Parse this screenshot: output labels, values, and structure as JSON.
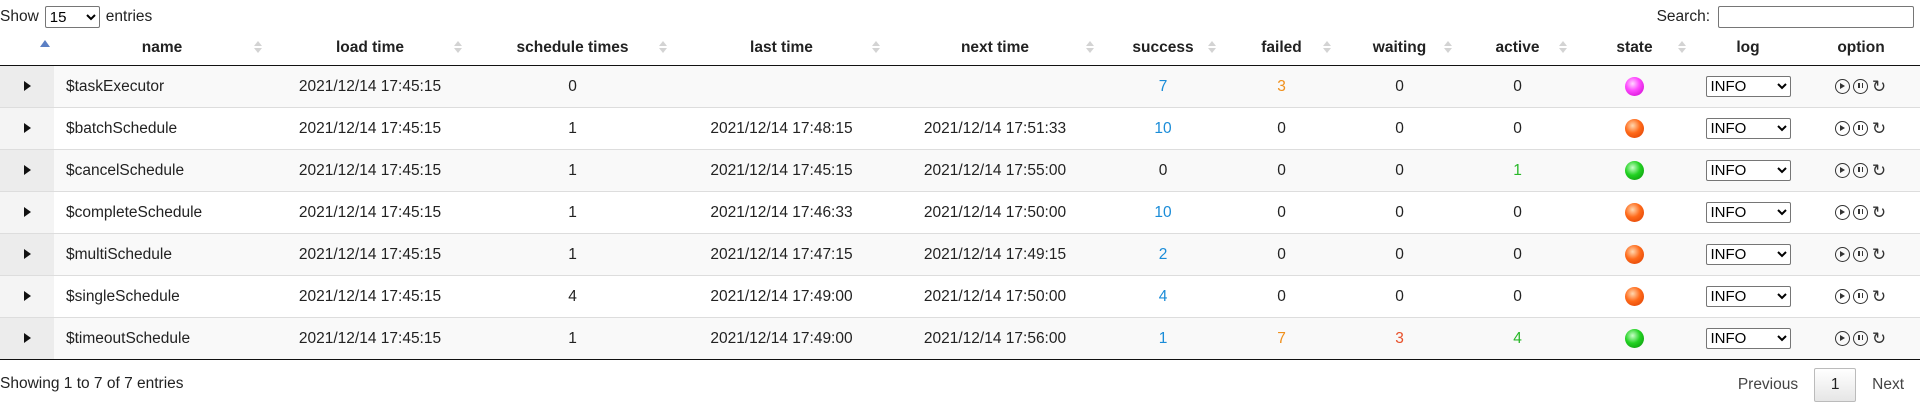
{
  "length_control": {
    "prefix": "Show",
    "value": "15",
    "suffix": "entries"
  },
  "search": {
    "label": "Search:",
    "value": ""
  },
  "columns": [
    "name",
    "load time",
    "schedule times",
    "last time",
    "next time",
    "success",
    "failed",
    "waiting",
    "active",
    "state",
    "log",
    "option"
  ],
  "rows": [
    {
      "name": "$taskExecutor",
      "load_time": "2021/12/14 17:45:15",
      "schedule_times": "0",
      "last_time": "",
      "next_time": "",
      "success": "7",
      "failed": "3",
      "waiting": "0",
      "active": "0",
      "state": "magenta",
      "log": "INFO"
    },
    {
      "name": "$batchSchedule",
      "load_time": "2021/12/14 17:45:15",
      "schedule_times": "1",
      "last_time": "2021/12/14 17:48:15",
      "next_time": "2021/12/14 17:51:33",
      "success": "10",
      "failed": "0",
      "waiting": "0",
      "active": "0",
      "state": "orange",
      "log": "INFO"
    },
    {
      "name": "$cancelSchedule",
      "load_time": "2021/12/14 17:45:15",
      "schedule_times": "1",
      "last_time": "2021/12/14 17:45:15",
      "next_time": "2021/12/14 17:55:00",
      "success": "0",
      "failed": "0",
      "waiting": "0",
      "active": "1",
      "state": "green",
      "log": "INFO"
    },
    {
      "name": "$completeSchedule",
      "load_time": "2021/12/14 17:45:15",
      "schedule_times": "1",
      "last_time": "2021/12/14 17:46:33",
      "next_time": "2021/12/14 17:50:00",
      "success": "10",
      "failed": "0",
      "waiting": "0",
      "active": "0",
      "state": "orange",
      "log": "INFO"
    },
    {
      "name": "$multiSchedule",
      "load_time": "2021/12/14 17:45:15",
      "schedule_times": "1",
      "last_time": "2021/12/14 17:47:15",
      "next_time": "2021/12/14 17:49:15",
      "success": "2",
      "failed": "0",
      "waiting": "0",
      "active": "0",
      "state": "orange",
      "log": "INFO"
    },
    {
      "name": "$singleSchedule",
      "load_time": "2021/12/14 17:45:15",
      "schedule_times": "4",
      "last_time": "2021/12/14 17:49:00",
      "next_time": "2021/12/14 17:50:00",
      "success": "4",
      "failed": "0",
      "waiting": "0",
      "active": "0",
      "state": "orange",
      "log": "INFO"
    },
    {
      "name": "$timeoutSchedule",
      "load_time": "2021/12/14 17:45:15",
      "schedule_times": "1",
      "last_time": "2021/12/14 17:49:00",
      "next_time": "2021/12/14 17:56:00",
      "success": "1",
      "failed": "7",
      "waiting": "3",
      "active": "4",
      "state": "green",
      "log": "INFO"
    }
  ],
  "footer": {
    "info": "Showing 1 to 7 of 7 entries",
    "previous": "Previous",
    "page": "1",
    "next": "Next"
  },
  "colors": {
    "success": "#1a8cd8",
    "failed": "#f0901c",
    "waiting": "#e8502a",
    "active": "#29b829"
  },
  "icons": {
    "expand": "expand-triangle-icon",
    "start": "play-circle-icon",
    "pause": "pause-circle-icon",
    "reload": "reload-icon"
  }
}
